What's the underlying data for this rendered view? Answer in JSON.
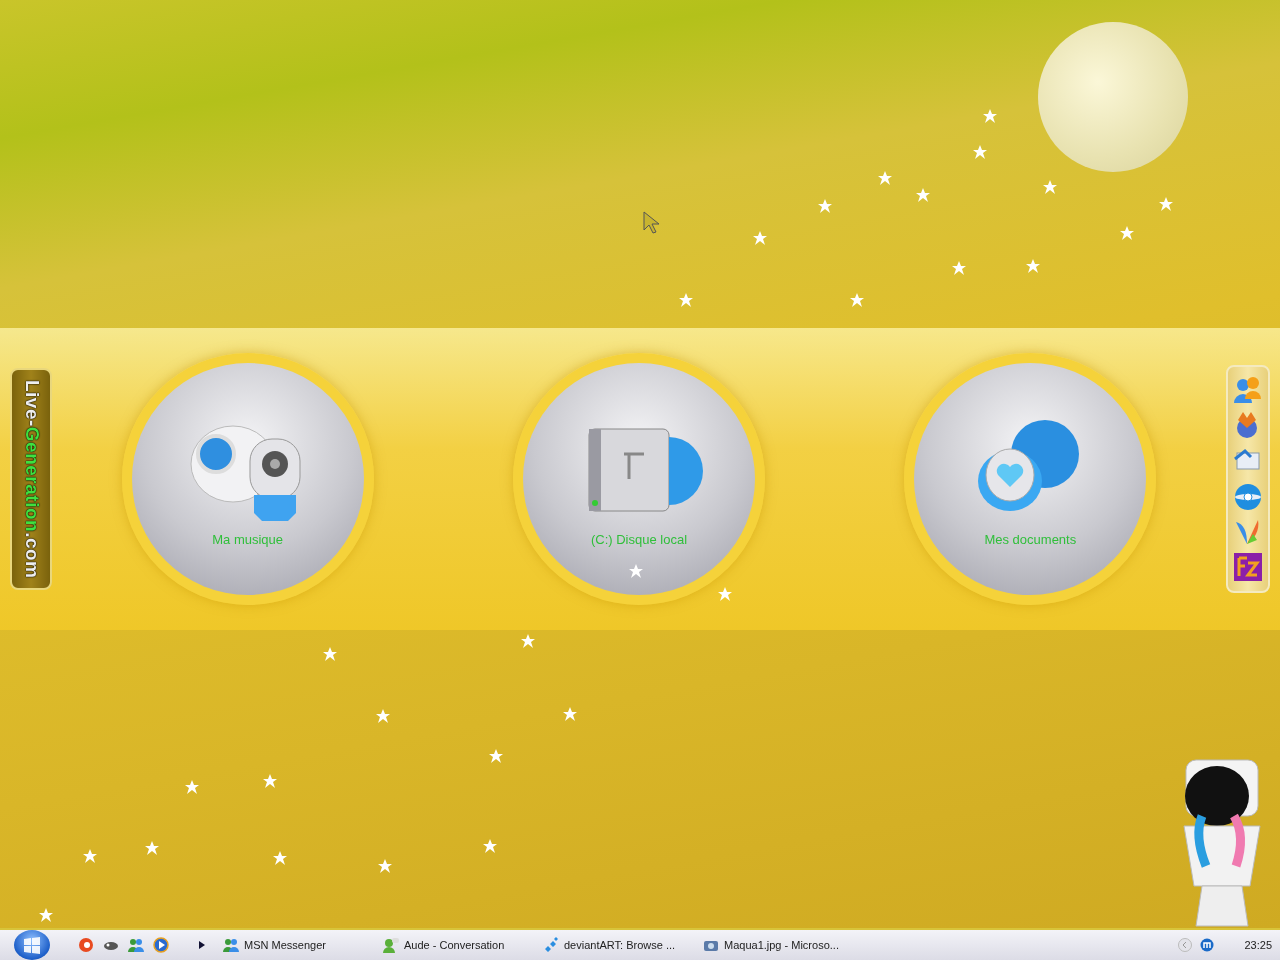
{
  "side_logo": [
    {
      "text": "Live-",
      "color": "#eeeeee"
    },
    {
      "text": "Generation",
      "color": "#3fe03f"
    },
    {
      "text": ".com",
      "color": "#eeeeee"
    }
  ],
  "desktop_shortcuts": [
    {
      "label": "Ma musique",
      "kind": "music"
    },
    {
      "label": "(C:) Disque local",
      "kind": "drive"
    },
    {
      "label": "Mes documents",
      "kind": "documents"
    }
  ],
  "taskbar": {
    "tasks": [
      {
        "label": "MSN Messenger",
        "kind": "messenger"
      },
      {
        "label": "Aude - Conversation",
        "kind": "chat"
      },
      {
        "label": "deviantART: Browse ...",
        "kind": "web"
      },
      {
        "label": "Maqua1.jpg - Microso...",
        "kind": "photo"
      }
    ],
    "clock": "23:25"
  }
}
